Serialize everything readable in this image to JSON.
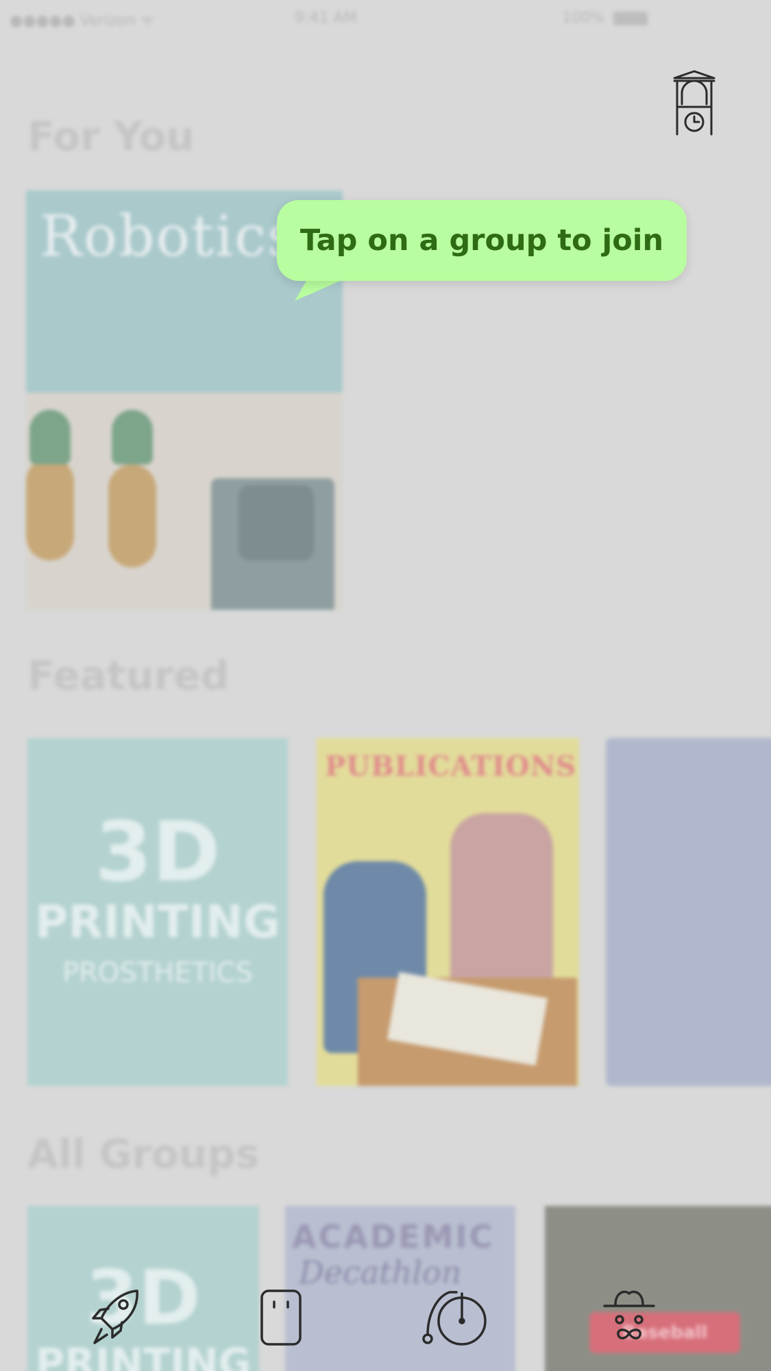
{
  "status_bar": {
    "carrier": "●●●●● Verizon ᯤ",
    "time": "9:41 AM",
    "battery_pct": "100%"
  },
  "sections": {
    "for_you": "For You",
    "featured": "Featured",
    "all_groups": "All Groups"
  },
  "tiles": {
    "robotics_title": "Robotics",
    "printing_3d": {
      "big": "3D",
      "line2": "PRINTING",
      "line3": "PROSTHETICS"
    },
    "publications_title": "PUBLICATIONS",
    "academic": {
      "line1": "ACADEMIC",
      "line2": "Decathlon"
    },
    "sport_badge": "Baseball"
  },
  "tooltip": {
    "text": "Tap on a group to join"
  },
  "header_icon": "clock-tower-icon",
  "tab_bar": {
    "tabs": [
      "rocket-icon",
      "device-icon",
      "penny-farthing-icon",
      "hat-mustache-icon"
    ]
  },
  "colors": {
    "tooltip_bg": "#b8fd9f",
    "tooltip_text": "#2e6b14",
    "icon_stroke": "#2b2b2b"
  }
}
